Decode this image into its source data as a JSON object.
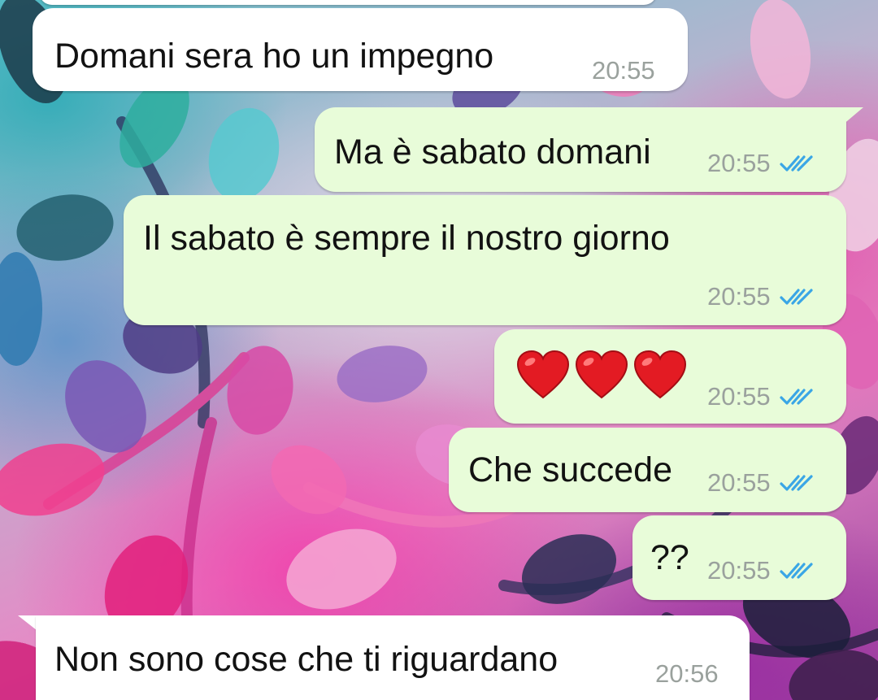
{
  "colors": {
    "incoming_bubble": "#ffffff",
    "outgoing_bubble": "#e8fcd9",
    "timestamp": "#9aa19d",
    "read_ticks": "#3aa6e6",
    "heart": "#e31b23"
  },
  "messages": [
    {
      "direction": "incoming",
      "text": "Domani sera ho un impegno",
      "time": "20:55"
    },
    {
      "direction": "outgoing",
      "text": "Ma è sabato domani",
      "time": "20:55",
      "status": "read-double-check-icon"
    },
    {
      "direction": "outgoing",
      "text": "Il sabato è sempre il nostro giorno",
      "time": "20:55",
      "status": "read-double-check-icon"
    },
    {
      "direction": "outgoing",
      "emoji": [
        "red-heart",
        "red-heart",
        "red-heart"
      ],
      "time": "20:55",
      "status": "read-double-check-icon"
    },
    {
      "direction": "outgoing",
      "text": "Che succede",
      "time": "20:55",
      "status": "read-double-check-icon"
    },
    {
      "direction": "outgoing",
      "text": "??",
      "time": "20:55",
      "status": "read-double-check-icon"
    },
    {
      "direction": "incoming",
      "text": "Non sono cose che ti riguardano",
      "time": "20:56"
    }
  ]
}
